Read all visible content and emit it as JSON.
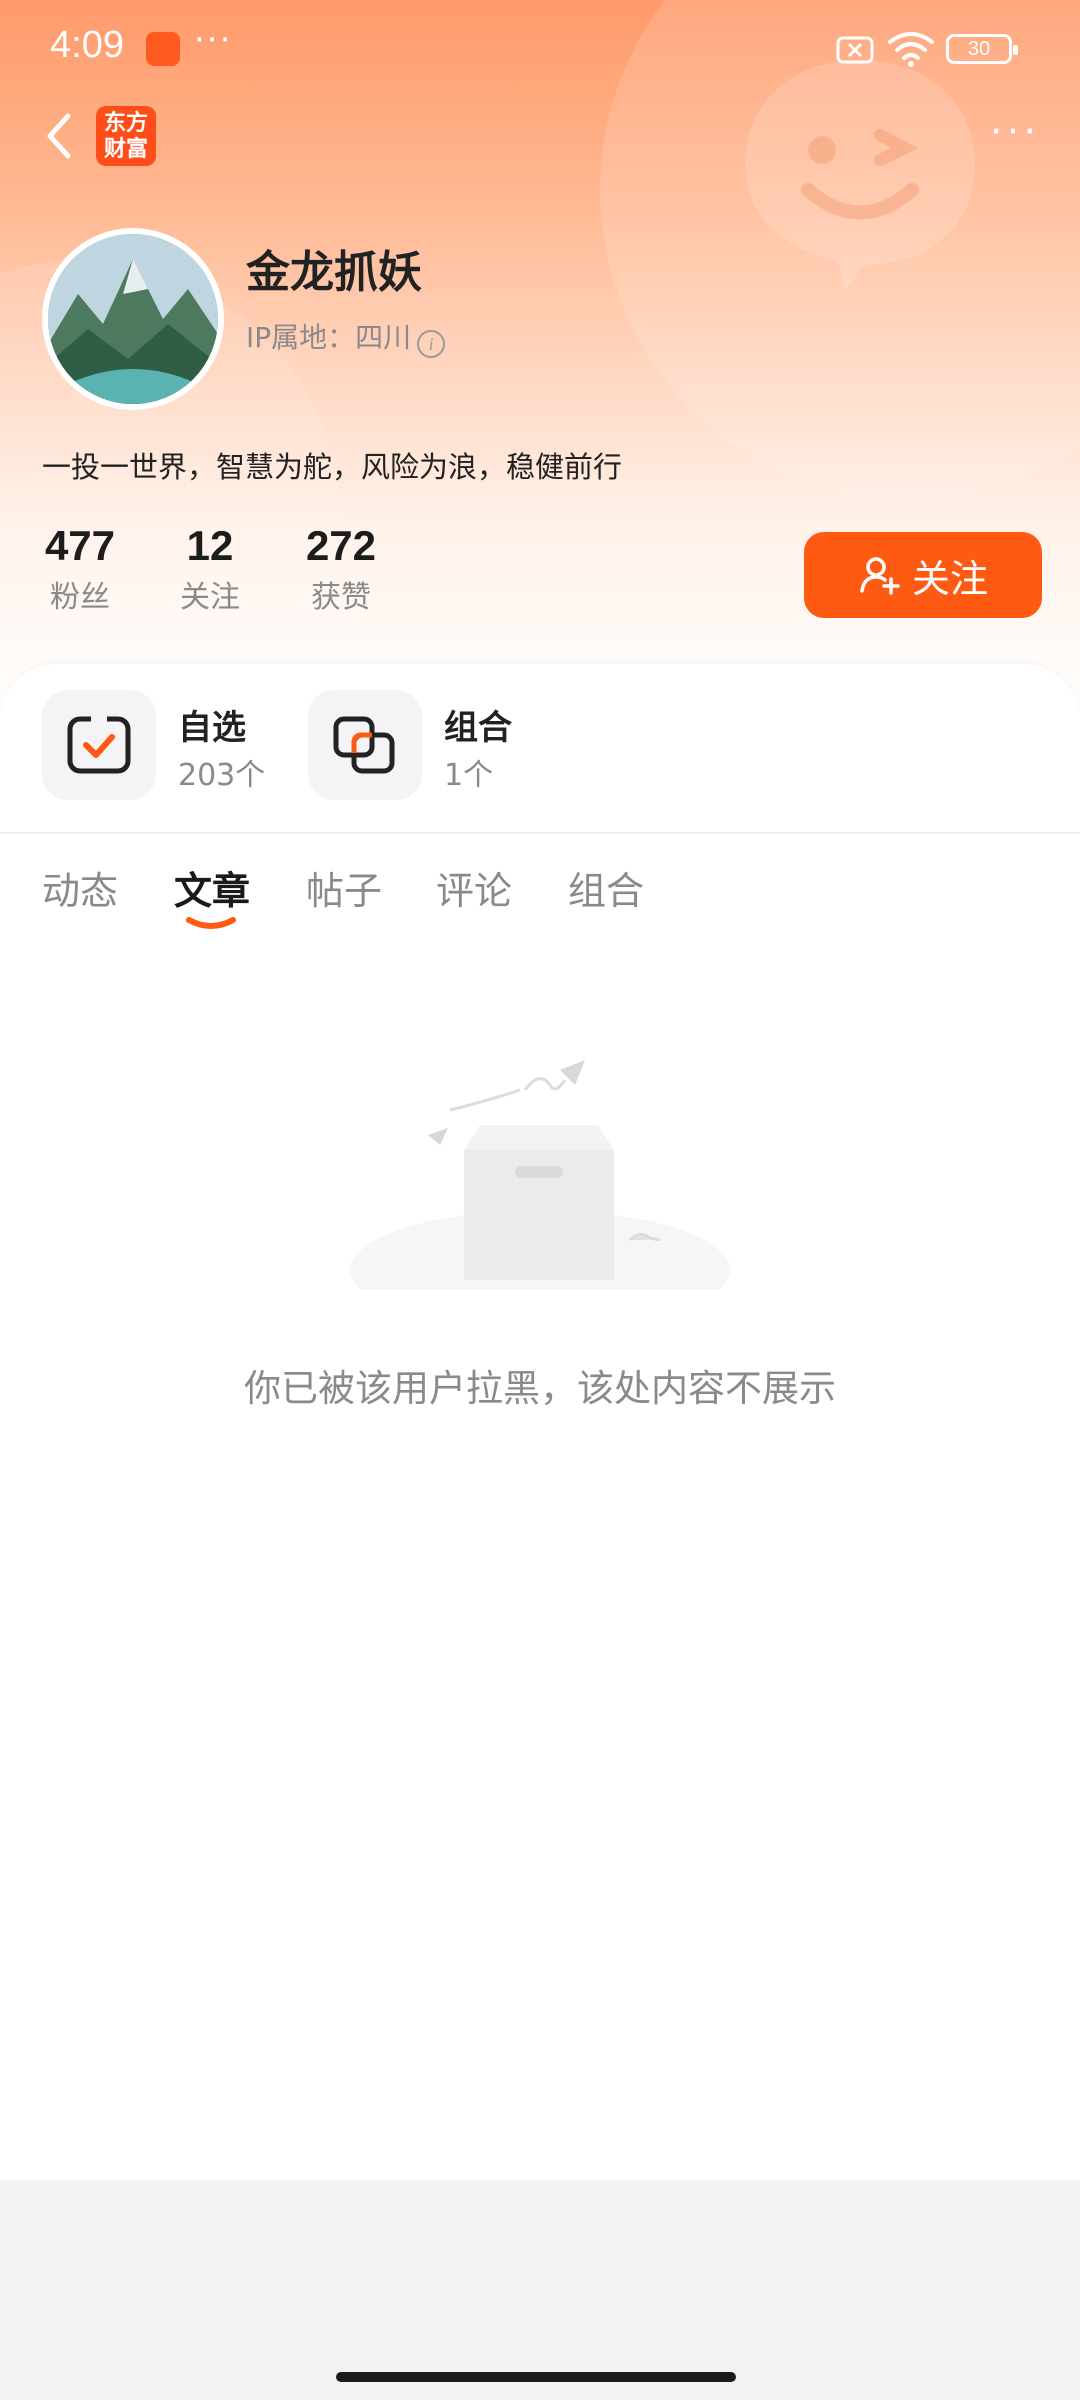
{
  "status_bar": {
    "time": "4:09",
    "more_dots": "···",
    "battery": "30"
  },
  "nav": {
    "logo_text": "东方财富",
    "more": "···"
  },
  "profile": {
    "name": "金龙抓妖",
    "ip_label": "IP属地：四川",
    "bio": "一投一世界，智慧为舵，风险为浪，稳健前行"
  },
  "stats": [
    {
      "value": "477",
      "label": "粉丝"
    },
    {
      "value": "12",
      "label": "关注"
    },
    {
      "value": "272",
      "label": "获赞"
    }
  ],
  "follow_button": "关注",
  "features": [
    {
      "title": "自选",
      "sub": "203个",
      "icon": "watchlist-icon"
    },
    {
      "title": "组合",
      "sub": "1个",
      "icon": "portfolio-icon"
    }
  ],
  "tabs": [
    {
      "label": "动态",
      "active": false
    },
    {
      "label": "文章",
      "active": true
    },
    {
      "label": "帖子",
      "active": false
    },
    {
      "label": "评论",
      "active": false
    },
    {
      "label": "组合",
      "active": false
    }
  ],
  "empty_state": {
    "message": "你已被该用户拉黑，该处内容不展示"
  },
  "colors": {
    "accent": "#ff5a12",
    "header_gradient_top": "#ff9a6a",
    "text_primary": "#222222",
    "text_secondary": "#8a8a8a"
  }
}
